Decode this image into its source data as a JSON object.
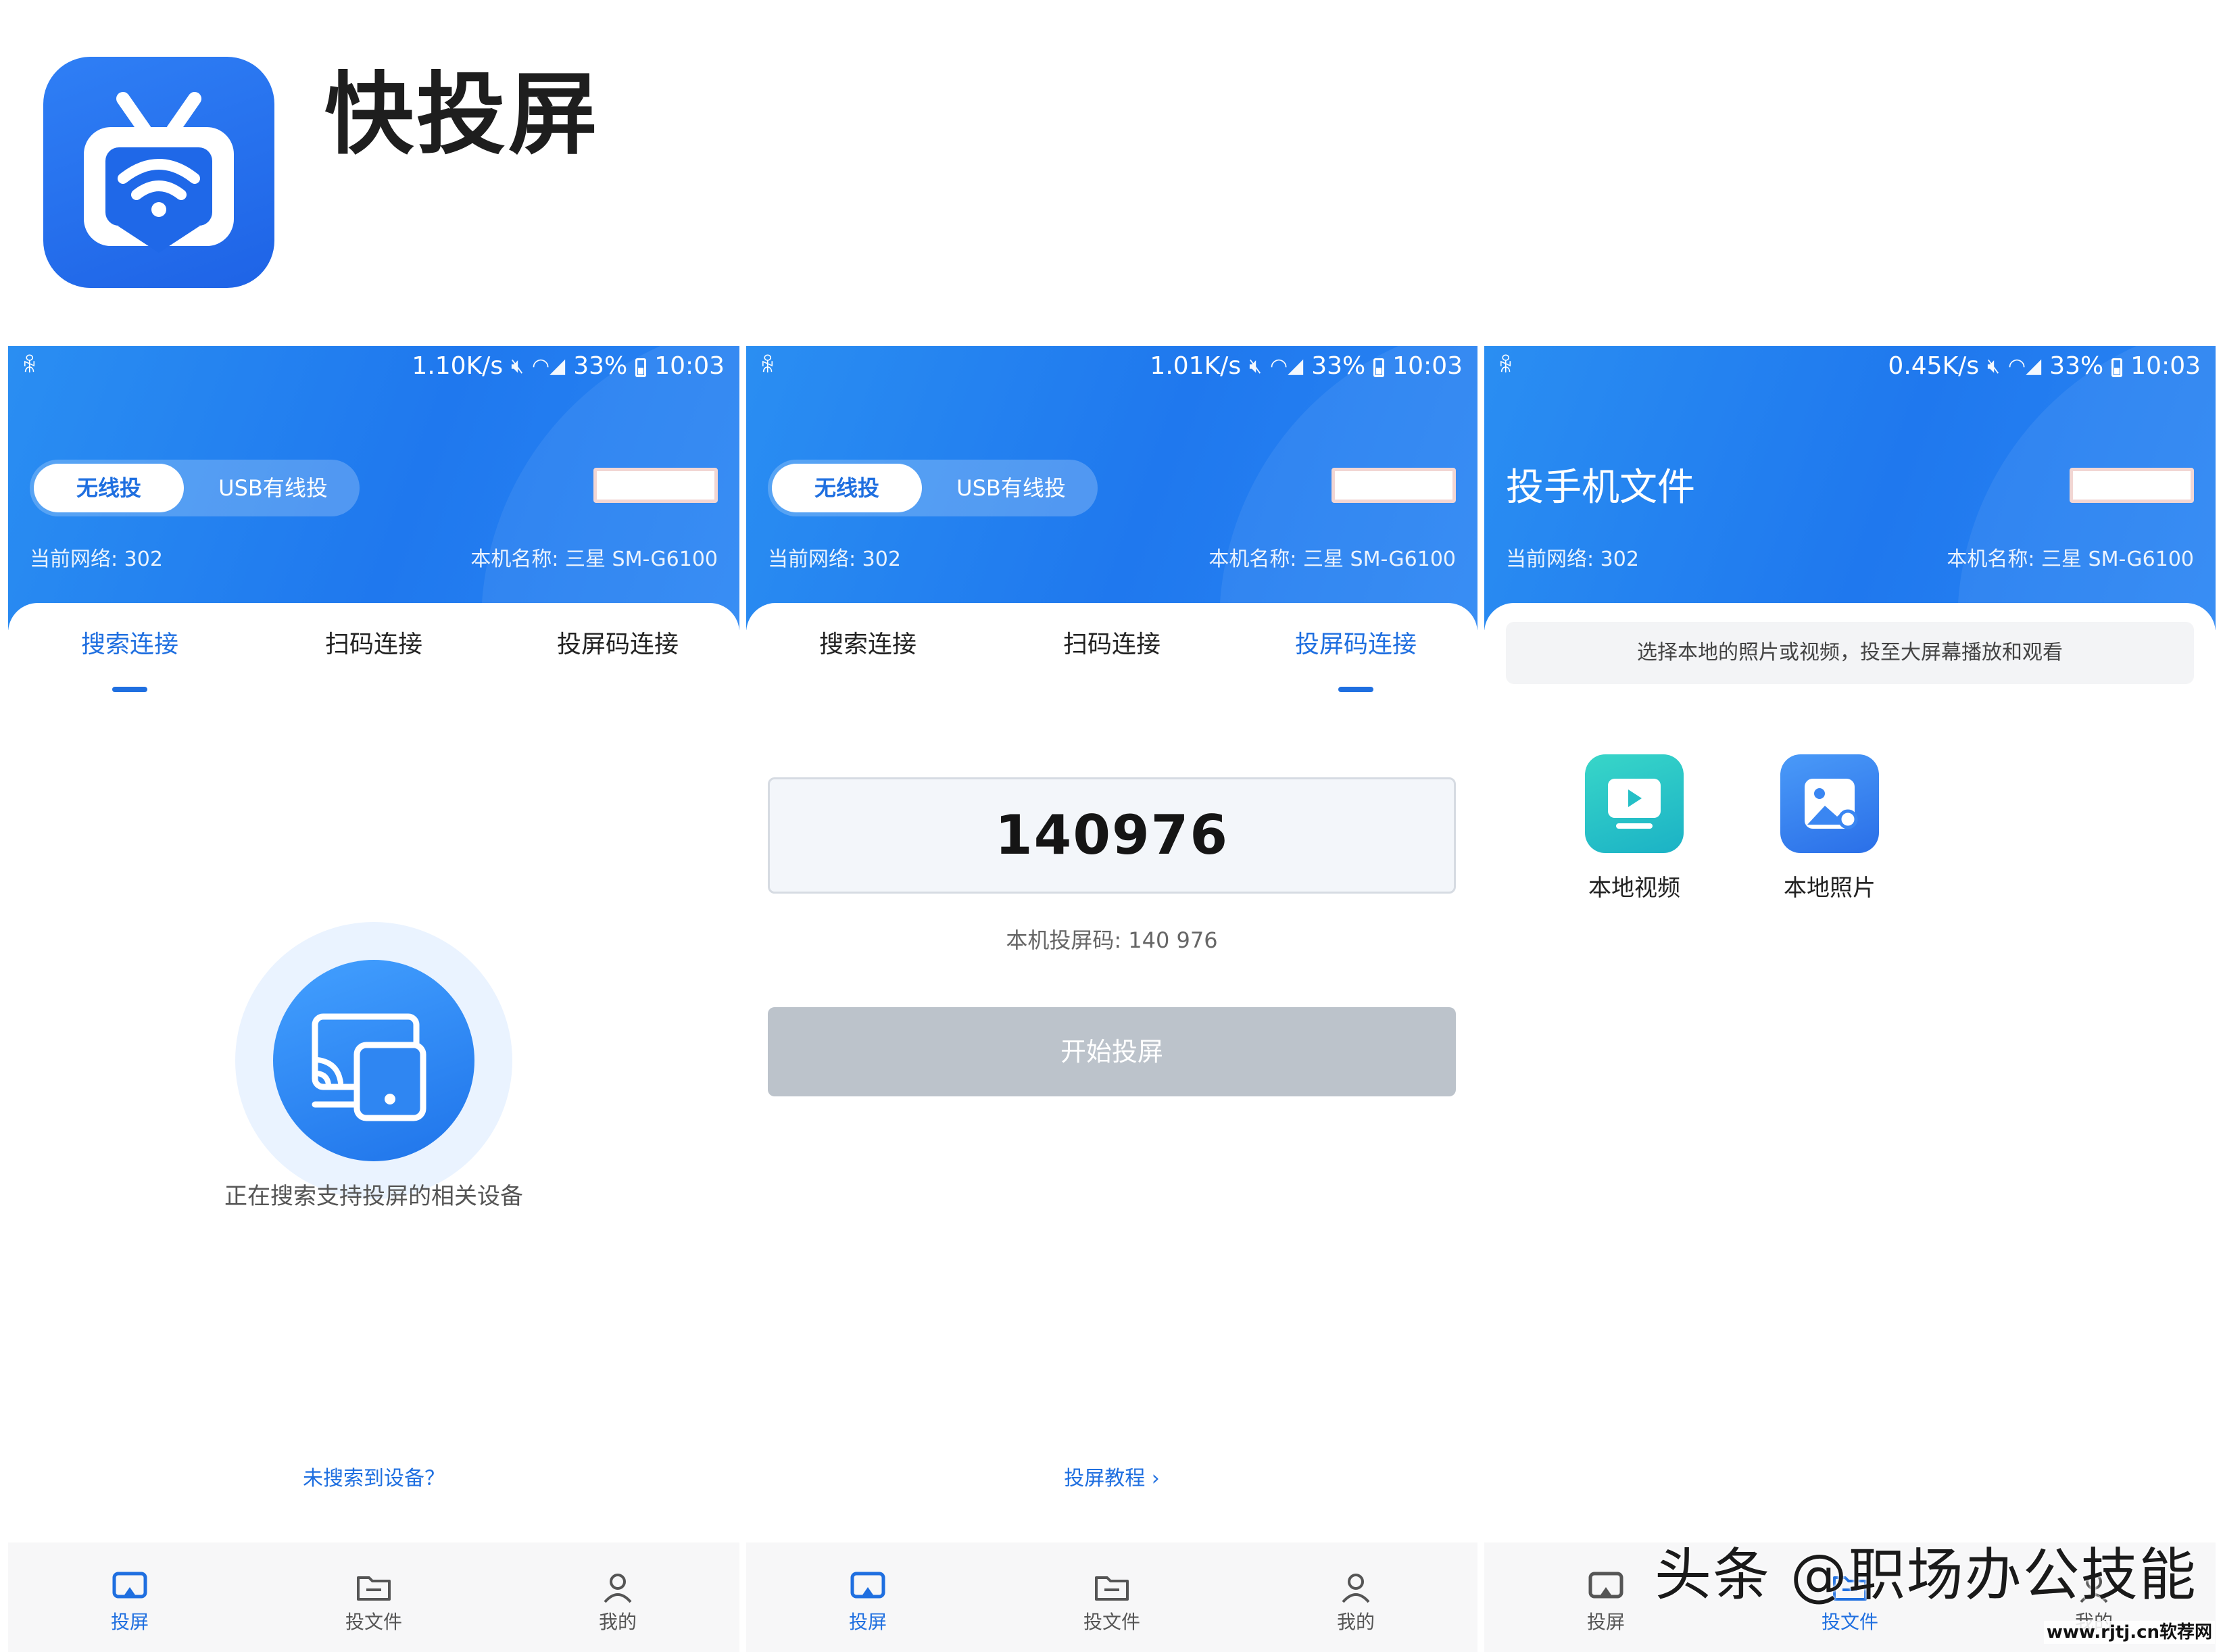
{
  "app": {
    "title": "快投屏",
    "logo_icon": "tv-wifi-icon",
    "brand_color": "#1f6fe0"
  },
  "phones": [
    {
      "status": {
        "speed": "1.10K/s",
        "battery": "33%",
        "time": "10:03"
      },
      "mode": {
        "active": "无线投",
        "inactive": "USB有线投"
      },
      "network": "当前网络: 302",
      "device": "本机名称: 三星 SM-G6100",
      "tabs": [
        "搜索连接",
        "扫码连接",
        "投屏码连接"
      ],
      "active_tab": 0,
      "searching_text": "正在搜索支持投屏的相关设备",
      "bottom_link": "未搜索到设备？",
      "nav": [
        "投屏",
        "投文件",
        "我的"
      ],
      "active_nav": 0
    },
    {
      "status": {
        "speed": "1.01K/s",
        "battery": "33%",
        "time": "10:03"
      },
      "mode": {
        "active": "无线投",
        "inactive": "USB有线投"
      },
      "network": "当前网络: 302",
      "device": "本机名称: 三星 SM-G6100",
      "tabs": [
        "搜索连接",
        "扫码连接",
        "投屏码连接"
      ],
      "active_tab": 2,
      "code": "140976",
      "code_caption": "本机投屏码: 140 976",
      "start_button": "开始投屏",
      "bottom_link": "投屏教程 ›",
      "nav": [
        "投屏",
        "投文件",
        "我的"
      ],
      "active_nav": 0
    },
    {
      "status": {
        "speed": "0.45K/s",
        "battery": "33%",
        "time": "10:03"
      },
      "heading": "投手机文件",
      "network": "当前网络: 302",
      "device": "本机名称: 三星 SM-G6100",
      "hint": "选择本地的照片或视频，投至大屏幕播放和观看",
      "files": [
        {
          "label": "本地视频",
          "icon": "video-play-icon"
        },
        {
          "label": "本地照片",
          "icon": "photo-icon"
        }
      ],
      "nav": [
        "投屏",
        "投文件",
        "我的"
      ],
      "active_nav": 1
    }
  ],
  "watermark": "头条 @职场办公技能",
  "site_mark": "www.rjtj.cn软荐网"
}
